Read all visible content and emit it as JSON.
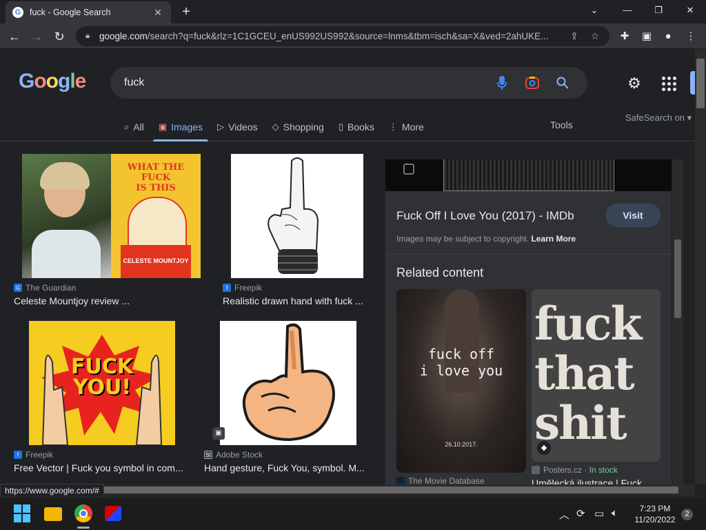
{
  "browser": {
    "tab_title": "fuck - Google Search",
    "favicon": "G",
    "url_domain": "google.com",
    "url_rest": "/search?q=fuck&rlz=1C1GCEU_enUS992US992&source=lnms&tbm=isch&sa=X&ved=2ahUKE...",
    "status_url": "https://www.google.com/#"
  },
  "google": {
    "logo": "Google",
    "query": "fuck",
    "tabs": [
      {
        "label": "All",
        "icon": "search-icon"
      },
      {
        "label": "Images",
        "icon": "image-icon"
      },
      {
        "label": "Videos",
        "icon": "play-icon"
      },
      {
        "label": "Shopping",
        "icon": "tag-icon"
      },
      {
        "label": "Books",
        "icon": "book-icon"
      },
      {
        "label": "More",
        "icon": "more-vert-icon"
      }
    ],
    "active_tab": "Images",
    "tools": "Tools",
    "safesearch": "SafeSearch on"
  },
  "results": [
    {
      "source": "The Guardian",
      "title": "Celeste Mountjoy review ...",
      "book_lines": [
        "WHAT THE",
        "FUCK",
        "IS THIS"
      ],
      "book_author": "CELESTE MOUNTJOY"
    },
    {
      "source": "Freepik",
      "title": "Realistic drawn hand with fuck ..."
    },
    {
      "source": "Freepik",
      "title": "Free Vector | Fuck you symbol in com...",
      "image_text": [
        "FUCK",
        "YOU!"
      ]
    },
    {
      "source": "Adobe Stock",
      "title": "Hand gesture, Fuck You, symbol. M..."
    }
  ],
  "panel": {
    "title": "Fuck Off I Love You (2017) - IMDb",
    "visit": "Visit",
    "copyright": "Images may be subject to copyright.",
    "learn_more": "Learn More",
    "related": "Related content",
    "related_items": [
      {
        "image_text": [
          "fuck off",
          "i love you"
        ],
        "date": "26.10.2017.",
        "source": "The Movie Database"
      },
      {
        "image_text": [
          "fuck",
          "that",
          "shit"
        ],
        "source": "Posters.cz",
        "stock": "In stock",
        "title": "Umělecká ilustrace | Fuck"
      }
    ]
  },
  "taskbar": {
    "time": "7:23 PM",
    "date": "11/20/2022",
    "notifications": "2"
  }
}
